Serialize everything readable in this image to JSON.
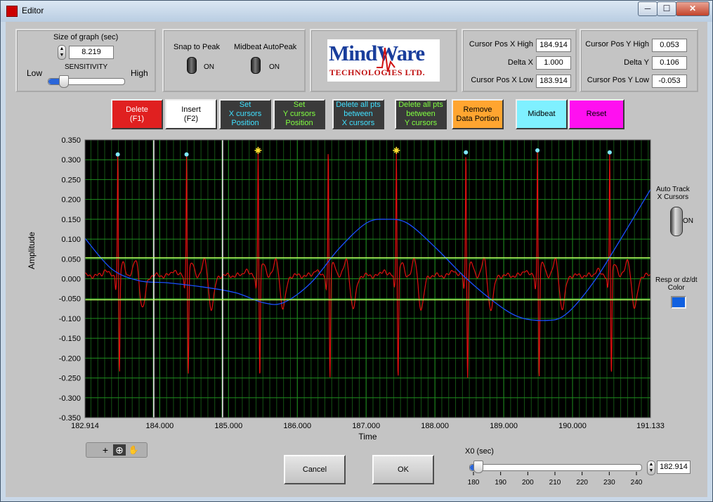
{
  "window": {
    "title": "Editor",
    "minimize": "─",
    "maximize": "☐",
    "close": "✕"
  },
  "graph_size": {
    "label": "Size of graph (sec)",
    "value": "8.219",
    "sensitivity_label": "SENSITIVITY",
    "low": "Low",
    "high": "High",
    "sensitivity_level": 0.2
  },
  "snap": {
    "snap_label": "Snap to Peak",
    "snap_state": "ON",
    "midbeat_label": "Midbeat AutoPeak",
    "midbeat_state": "ON"
  },
  "logo": {
    "line1": "MindWare",
    "line2": "TECHNOLOGIES LTD."
  },
  "cursors_x": {
    "high_label": "Cursor Pos X High",
    "high_value": "184.914",
    "delta_label": "Delta X",
    "delta_value": "1.000",
    "low_label": "Cursor Pos X Low",
    "low_value": "183.914"
  },
  "cursors_y": {
    "high_label": "Cursor Pos Y High",
    "high_value": "0.053",
    "delta_label": "Delta Y",
    "delta_value": "0.106",
    "low_label": "Cursor Pos Y Low",
    "low_value": "-0.053"
  },
  "actions": [
    {
      "label": "Delete\n(F1)",
      "bg": "#e02020",
      "fg": "#ffffff"
    },
    {
      "label": "Insert\n(F2)",
      "bg": "#ffffff",
      "fg": "#000000"
    },
    {
      "label": "Set\nX cursors\nPosition",
      "bg": "#3a3a3a",
      "fg": "#40e0ff"
    },
    {
      "label": "Set\nY cursors\nPosition",
      "bg": "#3a3a3a",
      "fg": "#80ff40"
    },
    {
      "label": "Delete all pts\nbetween\nX cursors",
      "bg": "#3a3a3a",
      "fg": "#40e0ff"
    },
    {
      "label": "Delete all pts\nbetween\nY cursors",
      "bg": "#3a3a3a",
      "fg": "#80ff40"
    },
    {
      "label": "Remove\nData Portion",
      "bg": "#ffa530",
      "fg": "#000000"
    },
    {
      "label": "Midbeat",
      "bg": "#7ff0ff",
      "fg": "#000000"
    },
    {
      "label": "Reset",
      "bg": "#ff10f0",
      "fg": "#000000"
    }
  ],
  "side": {
    "auto_track": "Auto Track\nX Cursors",
    "auto_state": "ON",
    "resp_label": "Resp or dz/dt\nColor",
    "resp_color": "#1060e0"
  },
  "chart_data": {
    "type": "line",
    "xlabel": "Time",
    "ylabel": "Amplitude",
    "xlim": [
      182.914,
      191.133
    ],
    "ylim": [
      -0.35,
      0.35
    ],
    "x_ticks": [
      "182.914",
      "184.000",
      "185.000",
      "186.000",
      "187.000",
      "188.000",
      "189.000",
      "190.000",
      "191.133"
    ],
    "x_tick_values": [
      182.914,
      184.0,
      185.0,
      186.0,
      187.0,
      188.0,
      189.0,
      190.0,
      191.133
    ],
    "y_ticks": [
      "0.350",
      "0.300",
      "0.250",
      "0.200",
      "0.150",
      "0.100",
      "0.050",
      "0.000",
      "-0.050",
      "-0.100",
      "-0.150",
      "-0.200",
      "-0.250",
      "-0.300",
      "-0.350"
    ],
    "y_tick_values": [
      0.35,
      0.3,
      0.25,
      0.2,
      0.15,
      0.1,
      0.05,
      0.0,
      -0.05,
      -0.1,
      -0.15,
      -0.2,
      -0.25,
      -0.3,
      -0.35
    ],
    "x_cursors": [
      183.914,
      184.914
    ],
    "y_cursors": [
      0.053,
      -0.053
    ],
    "peaks": [
      {
        "x": 183.39,
        "y": 0.31,
        "marker": "dot"
      },
      {
        "x": 184.39,
        "y": 0.31,
        "marker": "dot"
      },
      {
        "x": 185.43,
        "y": 0.32,
        "marker": "star"
      },
      {
        "x": 186.45,
        "y": 0.32,
        "marker": "none"
      },
      {
        "x": 187.44,
        "y": 0.32,
        "marker": "star"
      },
      {
        "x": 188.45,
        "y": 0.315,
        "marker": "dot"
      },
      {
        "x": 189.49,
        "y": 0.32,
        "marker": "dot"
      },
      {
        "x": 190.54,
        "y": 0.315,
        "marker": "dot"
      }
    ],
    "series": [
      {
        "color": "#e01010"
      },
      {
        "color": "#1a4fff",
        "x": [
          182.914,
          183.3,
          183.7,
          184.1,
          184.6,
          185.1,
          185.5,
          185.8,
          186.2,
          186.6,
          187.0,
          187.3,
          187.6,
          188.0,
          188.4,
          188.8,
          189.2,
          189.6,
          189.9,
          190.3,
          190.7,
          191.133
        ],
        "y": [
          0.102,
          0.025,
          -0.005,
          -0.01,
          -0.02,
          -0.035,
          -0.06,
          -0.06,
          -0.01,
          0.075,
          0.14,
          0.15,
          0.14,
          0.08,
          0.01,
          -0.05,
          -0.095,
          -0.105,
          -0.09,
          -0.01,
          0.1,
          0.225
        ]
      }
    ]
  },
  "toolbar": {
    "cross": "+",
    "zoom": "⊕",
    "hand": "✋"
  },
  "buttons": {
    "cancel": "Cancel",
    "ok": "OK"
  },
  "x0": {
    "label": "X0 (sec)",
    "value": "182.914",
    "scale": [
      "180",
      "190",
      "200",
      "210",
      "220",
      "230",
      "240"
    ],
    "scale_values": [
      180,
      190,
      200,
      210,
      220,
      230,
      240
    ],
    "range": [
      180,
      240
    ],
    "position": 182.914
  }
}
